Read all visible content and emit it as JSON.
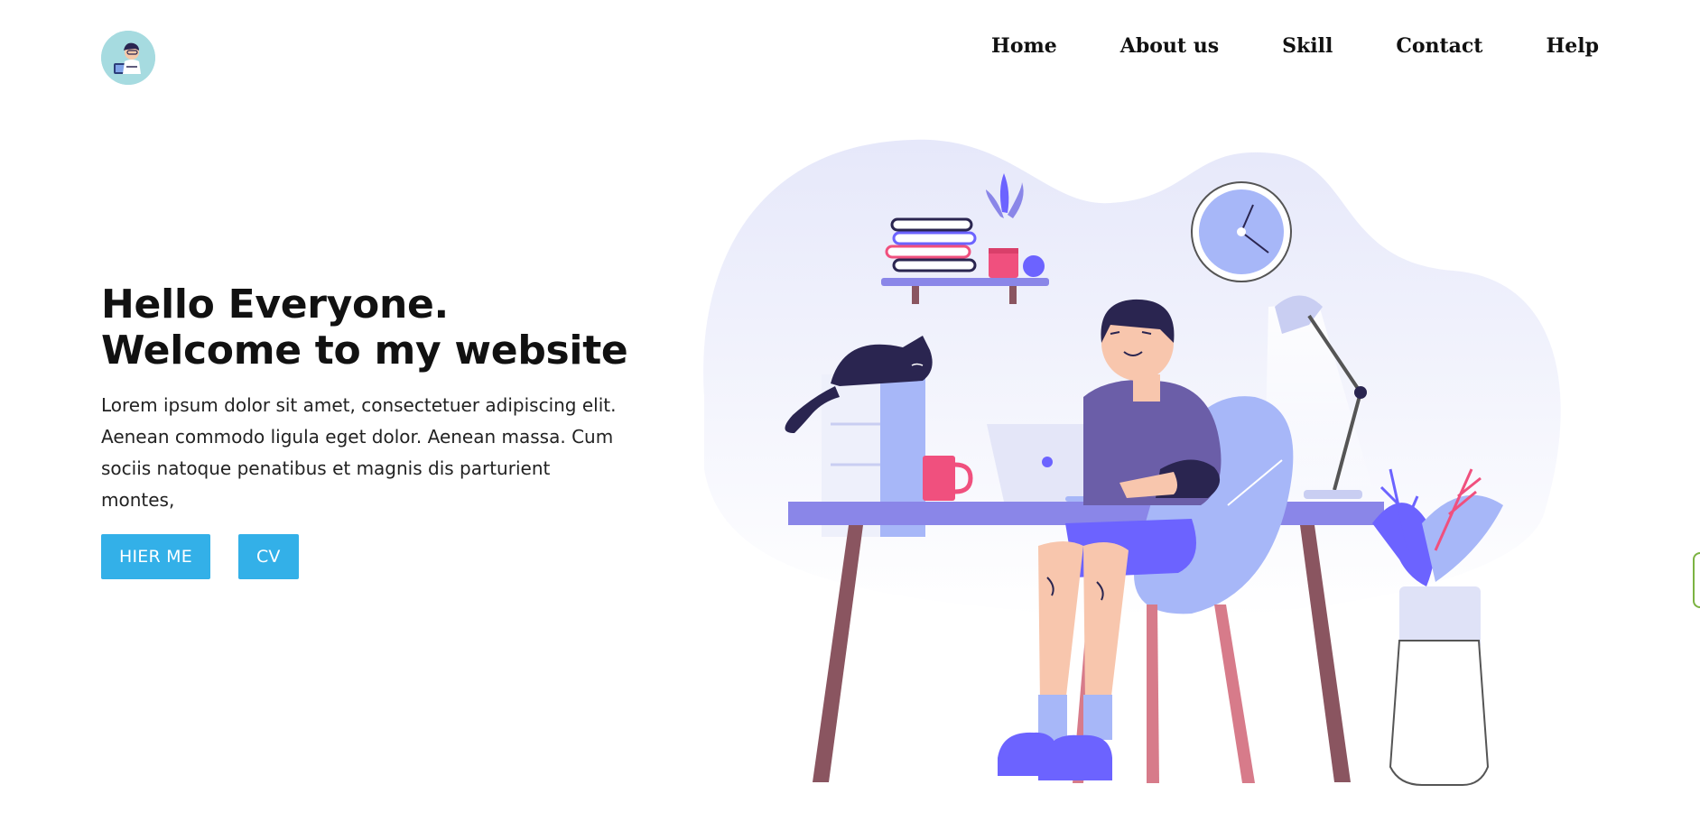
{
  "nav": {
    "logo_icon": "developer-avatar-icon",
    "items": [
      {
        "label": "Home"
      },
      {
        "label": "About us"
      },
      {
        "label": "Skill"
      },
      {
        "label": "Contact"
      },
      {
        "label": "Help"
      }
    ]
  },
  "hero": {
    "title": "Hello Everyone. Welcome to my website",
    "description": "Lorem ipsum dolor sit amet, consectetuer adipiscing elit. Aenean commodo ligula eget dolor. Aenean massa. Cum sociis natoque penatibus et magnis dis parturient montes,",
    "buttons": {
      "hire_label": "HIER ME",
      "cv_label": "CV"
    }
  },
  "illustration": {
    "icon": "developer-at-desk-illustration"
  },
  "colors": {
    "accent": "#33b0e8",
    "logo_bg": "#a6dbe0",
    "purple": "#6c63ff",
    "pink": "#f0507e"
  }
}
